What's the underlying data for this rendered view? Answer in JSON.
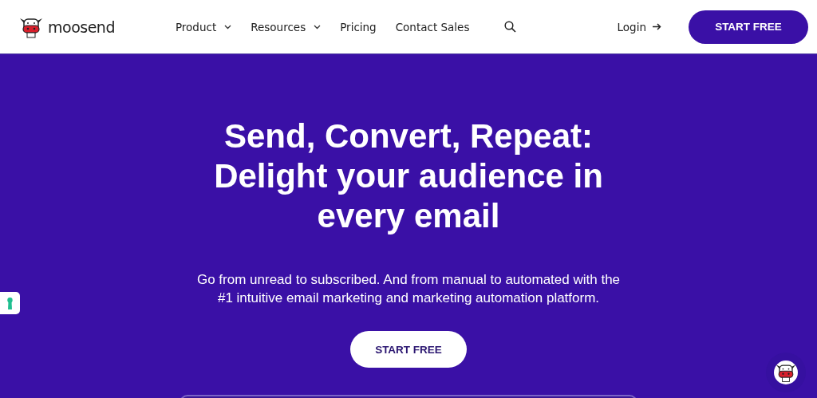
{
  "header": {
    "logo": "moosend",
    "nav": [
      {
        "label": "Product",
        "dropdown": true
      },
      {
        "label": "Resources",
        "dropdown": true
      },
      {
        "label": "Pricing",
        "dropdown": false
      },
      {
        "label": "Contact Sales",
        "dropdown": false
      }
    ],
    "login": "Login",
    "cta": "START FREE"
  },
  "hero": {
    "title_lines": [
      "Send, Convert, Repeat:",
      "Delight your audience in",
      "every email"
    ],
    "subtitle_lines": [
      "Go from unread to subscribed. And from manual to automated with the",
      "#1 intuitive email marketing and marketing automation platform."
    ],
    "cta": "START FREE"
  }
}
